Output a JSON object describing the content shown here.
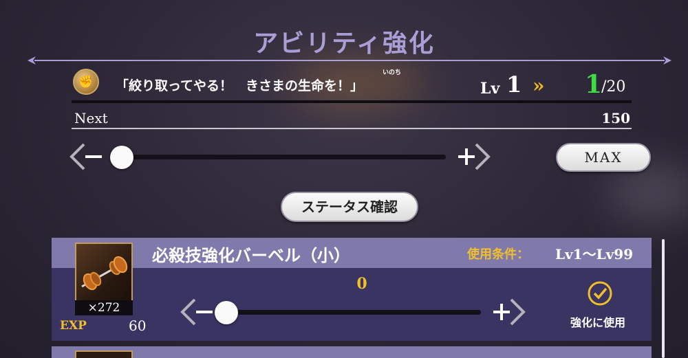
{
  "screen": {
    "title": "アビリティ強化"
  },
  "ability": {
    "name": "「絞り取ってやる！　きさまの生命を！」",
    "ruby": "いのち",
    "lv_prefix": "Lv",
    "current_level": "1",
    "new_level": "1",
    "max_level": "/20",
    "next_label": "Next",
    "next_exp": "150"
  },
  "level_slider": {
    "value_fraction": 0
  },
  "buttons": {
    "max": "MAX",
    "status_check": "ステータス確認"
  },
  "items": [
    {
      "name": "必殺技強化バーベル（小）",
      "condition_label": "使用条件：",
      "condition_value": "Lv1～Lv99",
      "count": "×272",
      "exp_label": "EXP",
      "exp_value": "60",
      "use_quantity": "0",
      "use_label": "強化に使用",
      "slider_fraction": 0
    }
  ],
  "colors": {
    "title": "#a99fd6",
    "accent_gold": "#f2bf2a",
    "level_up_green": "#3ddc45",
    "item_header": "#7f7aab",
    "item_body": "#3a3463"
  },
  "icons": {
    "ability": "fist-emblem-icon",
    "item": "barbell-icon",
    "decrease": "arrow-minus-icon",
    "increase": "arrow-plus-icon",
    "level_arrow": "double-chevron-right-icon",
    "use_check": "check-circle-icon"
  }
}
